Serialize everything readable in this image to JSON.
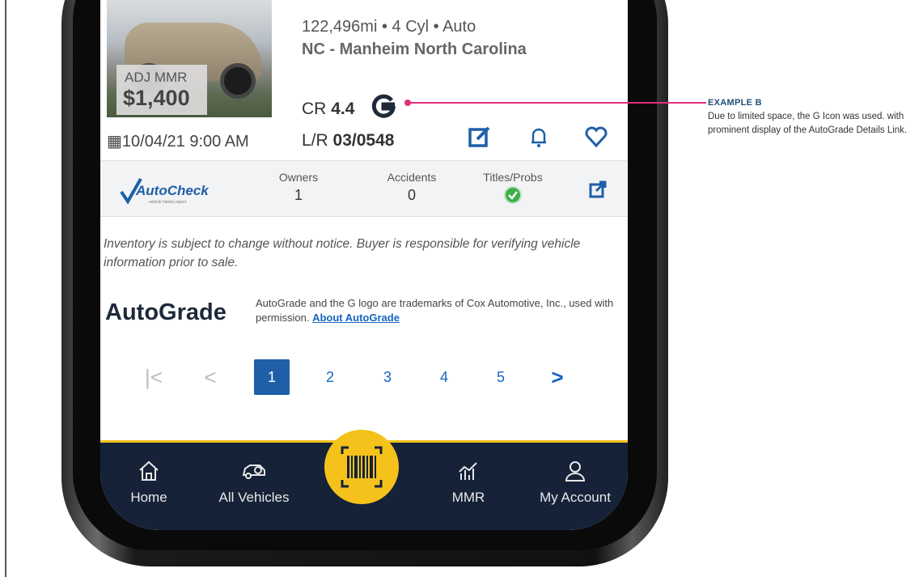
{
  "listing": {
    "mmr_label": "ADJ MMR",
    "mmr_value": "$1,400",
    "specs": "122,496mi • 4 Cyl • Auto",
    "location": "NC - Manheim North Carolina",
    "cr_prefix": "CR",
    "cr_value": "4.4",
    "date": "10/04/21 9:00 AM",
    "lr_prefix": "L/R",
    "lr_value": "03/0548"
  },
  "autocheck": {
    "logo_text": "AutoCheck",
    "logo_sub": "vehicle history report",
    "columns": [
      {
        "header": "Owners",
        "value": "1"
      },
      {
        "header": "Accidents",
        "value": "0"
      },
      {
        "header": "Titles/Probs",
        "value": ""
      }
    ]
  },
  "disclaimer": "Inventory is subject to change without notice. Buyer is responsible for verifying vehicle information prior to sale.",
  "autograde": {
    "logo_text": "AutoGrade",
    "text": "AutoGrade and the G logo are trademarks of Cox Automotive, Inc., used with permission.",
    "link": "About AutoGrade"
  },
  "pagination": {
    "pages": [
      "1",
      "2",
      "3",
      "4",
      "5"
    ],
    "active": "1"
  },
  "nav": {
    "home": "Home",
    "all_vehicles": "All Vehicles",
    "mmr": "MMR",
    "my_account": "My Account"
  },
  "callout": {
    "title": "EXAMPLE B",
    "text": "Due to limited space, the G Icon was used.  with prominent display of the AutoGrade Details Link."
  },
  "colors": {
    "accent_blue": "#1f5fa8",
    "nav_bg": "#152238",
    "scan_yellow": "#f5c21b",
    "callout_pink": "#e0307a",
    "check_green": "#3fae49"
  }
}
